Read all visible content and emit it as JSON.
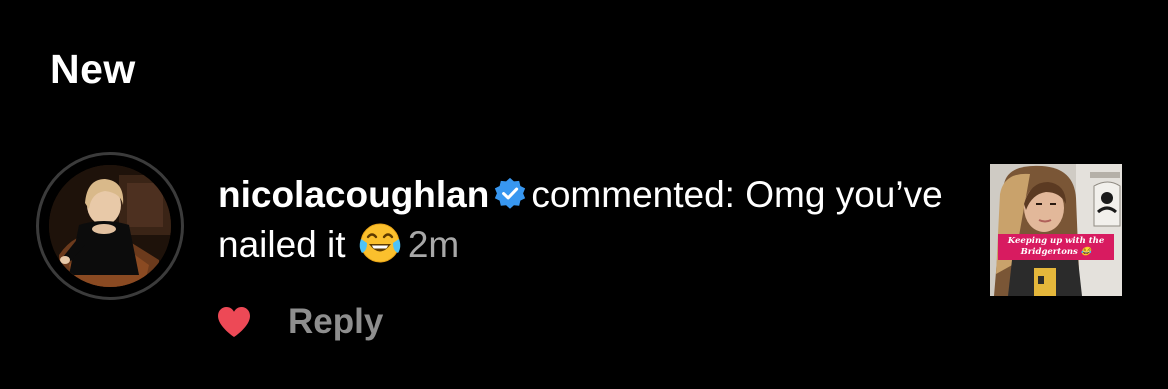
{
  "section": {
    "title": "New"
  },
  "notification": {
    "username": "nicolacoughlan",
    "verified_icon": "verified-badge-icon",
    "verified_color": "#3897f0",
    "action_text": "commented:",
    "comment": "Omg you’ve nailed it",
    "emoji_icon": "face-with-tears-of-joy-icon",
    "timestamp": "2m",
    "liked": true,
    "like_icon": "heart-icon",
    "like_color": "#ed4956",
    "reply_label": "Reply",
    "thumbnail": {
      "caption": "Keeping up with the Bridgertons 😂"
    }
  },
  "colors": {
    "background": "#000000",
    "text": "#ffffff",
    "muted": "#a8a8a8",
    "reply": "#8e8e8e"
  }
}
